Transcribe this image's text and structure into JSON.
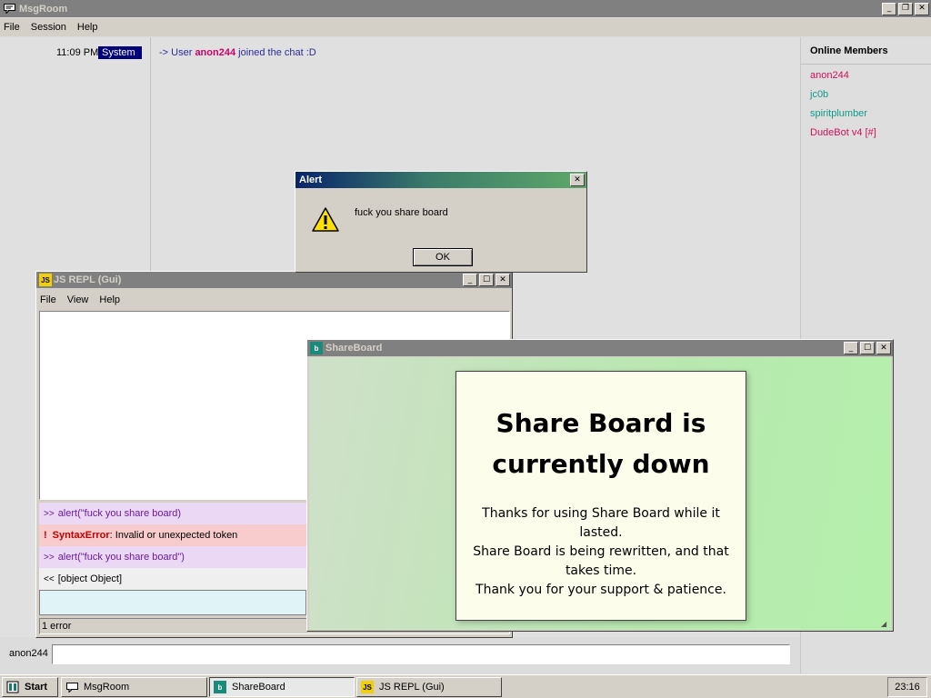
{
  "msgroom": {
    "title": "MsgRoom",
    "menu": [
      "File",
      "Session",
      "Help"
    ],
    "messages": [
      {
        "time": "11:09 PM",
        "sender": "System",
        "prefix": "-> User ",
        "user": "anon244",
        "suffix": " joined the chat :D"
      }
    ],
    "members_title": "Online Members",
    "members": [
      {
        "name": "anon244",
        "color": "#d0105a"
      },
      {
        "name": "jc0b",
        "color": "#109a8a"
      },
      {
        "name": "spiritplumber",
        "color": "#109a8a"
      },
      {
        "name": "DudeBot v4 [#]",
        "color": "#d0105a"
      }
    ],
    "input_user": "anon244",
    "input_value": ""
  },
  "alert": {
    "title": "Alert",
    "message": "fuck you share board",
    "ok_label": "OK"
  },
  "repl": {
    "title": "JS REPL (Gui)",
    "icon_text": "JS",
    "menu": [
      "File",
      "View",
      "Help"
    ],
    "lines": [
      {
        "type": "in",
        "prompt": ">>",
        "text": "alert(\"fuck you share board)"
      },
      {
        "type": "err",
        "mark": "!",
        "name": "SyntaxError",
        "text": ": Invalid or unexpected token"
      },
      {
        "type": "in",
        "prompt": ">>",
        "text": "alert(\"fuck you share board\")"
      },
      {
        "type": "out",
        "prompt": "<<",
        "text": "[object Object]"
      }
    ],
    "status": "1 error"
  },
  "shareboard": {
    "title": "ShareBoard",
    "icon_text": "b",
    "heading_lines": [
      "Share Board is",
      "currently down"
    ],
    "body_lines": [
      "Thanks for using Share Board while it",
      "lasted.",
      "Share Board is being rewritten, and that",
      "takes time.",
      "Thank you for your support & patience."
    ]
  },
  "taskbar": {
    "start_label": "Start",
    "tasks": [
      {
        "label": "MsgRoom",
        "icon": "msg-icon"
      },
      {
        "label": "ShareBoard",
        "icon": "shareboard-icon"
      },
      {
        "label": "JS REPL (Gui)",
        "icon": "js-icon"
      }
    ],
    "clock": "23:16"
  }
}
